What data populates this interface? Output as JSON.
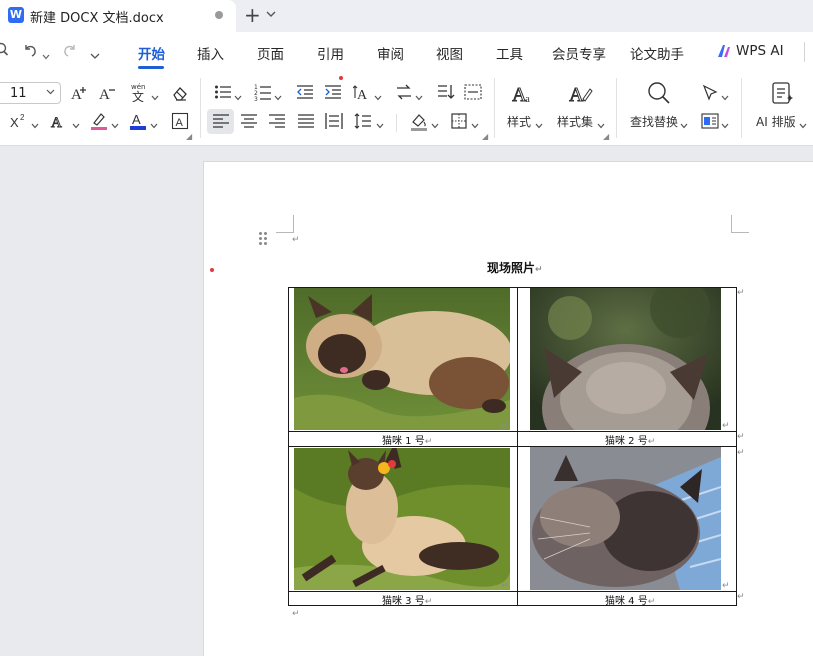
{
  "app": {
    "doc_title": "新建 DOCX 文档.docx",
    "logo_letter": "W",
    "new_tab": "+",
    "tab_chevron": "⌄"
  },
  "quick_access": {
    "search_icon": "⌕",
    "undo_icon": "↶",
    "redo_icon": "↷",
    "more_icon": "⌄"
  },
  "menu": {
    "items": [
      "开始",
      "插入",
      "页面",
      "引用",
      "审阅",
      "视图",
      "工具",
      "会员专享",
      "论文助手",
      "WPS AI"
    ],
    "active_index": 0
  },
  "ribbon": {
    "font_size": "11",
    "styles_label": "样式",
    "style_set_label": "样式集",
    "find_replace_label": "查找替换",
    "ai_layout_label": "AI 排版"
  },
  "document": {
    "heading": "现场照片",
    "para_mark": "↵",
    "captions": [
      "猫咪 1 号",
      "猫咪 2 号",
      "猫咪 3 号",
      "猫咪 4 号"
    ]
  },
  "colors": {
    "accent": "#1e5fd6",
    "font_color_bar": "#1a3fd9",
    "highlight_bar": "#e05a9a"
  }
}
